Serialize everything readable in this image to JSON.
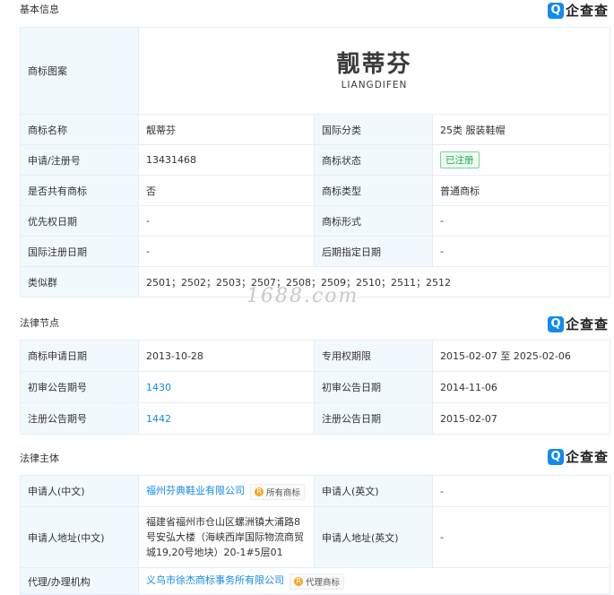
{
  "brand_name": "企查查",
  "brand_icon": "qichacha-logo-icon",
  "watermark": "1688.com",
  "basic": {
    "title": "基本信息",
    "trademark_image_label": "商标图案",
    "trademark_cn": "靓蒂芬",
    "trademark_en": "LIANGDIFEN",
    "rows": [
      {
        "l1": "商标名称",
        "v1": "靓蒂芬",
        "l2": "国际分类",
        "v2": "25类 服装鞋帽"
      },
      {
        "l1": "申请/注册号",
        "v1": "13431468",
        "l2": "商标状态",
        "v2": "已注册"
      },
      {
        "l1": "是否共有商标",
        "v1": "否",
        "l2": "商标类型",
        "v2": "普通商标"
      },
      {
        "l1": "优先权日期",
        "v1": "-",
        "l2": "商标形式",
        "v2": "-"
      },
      {
        "l1": "国际注册日期",
        "v1": "-",
        "l2": "后期指定日期",
        "v2": "-"
      }
    ],
    "similar_label": "类似群",
    "similar_value": "2501；2502；2503；2507；2508；2509；2510；2511；2512"
  },
  "legal_nodes": {
    "title": "法律节点",
    "rows": [
      {
        "l1": "商标申请日期",
        "v1": "2013-10-28",
        "l2": "专用权期限",
        "v2": "2015-02-07 至 2025-02-06"
      },
      {
        "l1": "初审公告期号",
        "v1": "1430",
        "l2": "初审公告日期",
        "v2": "2014-11-06"
      },
      {
        "l1": "注册公告期号",
        "v1": "1442",
        "l2": "注册公告日期",
        "v2": "2015-02-07"
      }
    ]
  },
  "legal_subject": {
    "title": "法律主体",
    "applicant_cn_label": "申请人(中文)",
    "applicant_cn": "福州芬典鞋业有限公司",
    "applicant_tag": "所有商标",
    "applicant_en_label": "申请人(英文)",
    "applicant_en": "-",
    "address_cn_label": "申请人地址(中文)",
    "address_cn": "福建省福州市仓山区螺洲镇大浦路8号安弘大楼（海峡西岸国际物流商贸城19,20号地块）20-1#5层01",
    "address_en_label": "申请人地址(英文)",
    "address_en": "-",
    "agent_label": "代理/办理机构",
    "agent": "义乌市徐杰商标事务所有限公司",
    "agent_tag": "代理商标"
  }
}
